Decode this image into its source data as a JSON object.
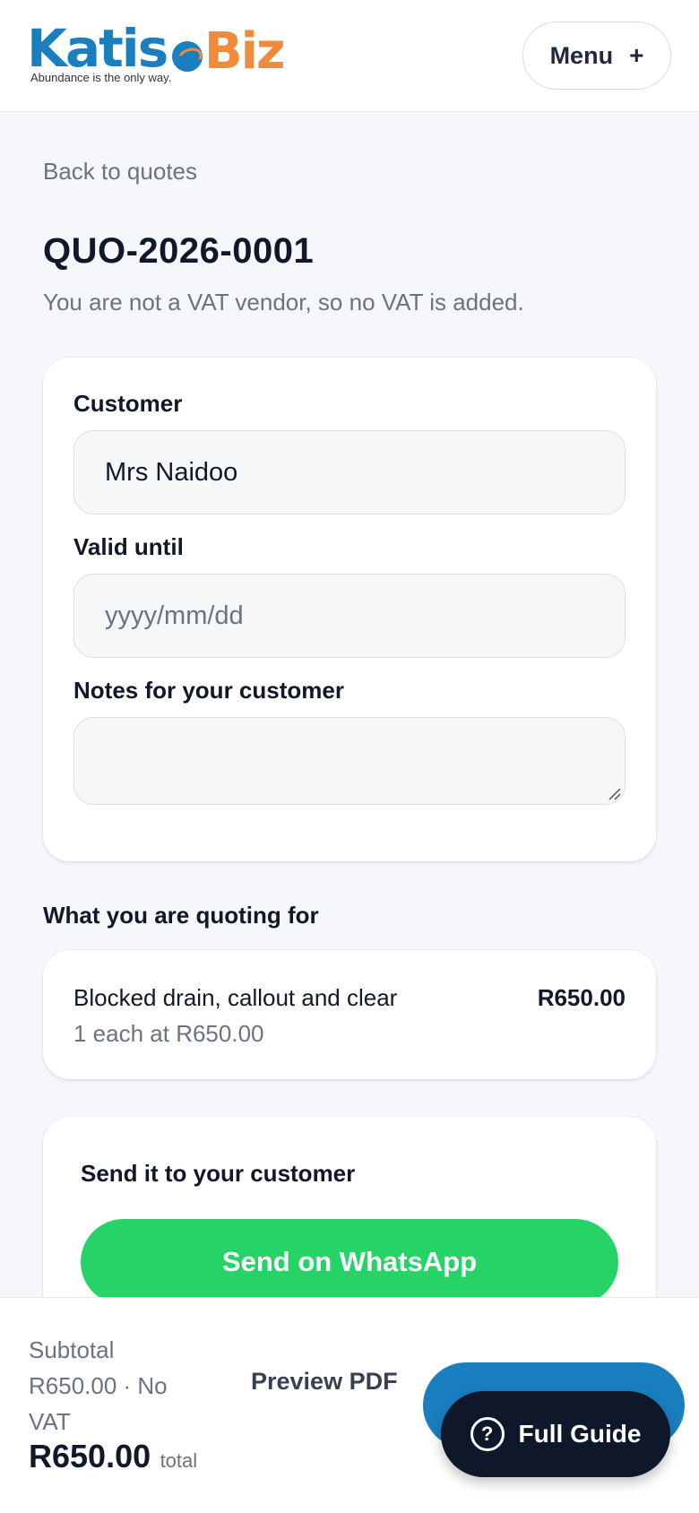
{
  "header": {
    "logo_part1": "Katis",
    "logo_part2": "Biz",
    "logo_tagline": "Abundance is the only way.",
    "menu_label": "Menu",
    "menu_icon": "+"
  },
  "nav": {
    "back_label": "Back to quotes"
  },
  "quote": {
    "number": "QUO-2026-0001",
    "vat_note": "You are not a VAT vendor, so no VAT is added."
  },
  "form": {
    "customer_label": "Customer",
    "customer_value": "Mrs Naidoo",
    "valid_until_label": "Valid until",
    "valid_until_placeholder": "yyyy/mm/dd",
    "notes_label": "Notes for your customer",
    "notes_value": ""
  },
  "items_section": {
    "heading": "What you are quoting for",
    "items": [
      {
        "name": "Blocked drain, callout and clear",
        "price": "R650.00",
        "detail": "1 each at R650.00"
      }
    ]
  },
  "send": {
    "title": "Send it to your customer",
    "whatsapp_label": "Send on WhatsApp"
  },
  "footer": {
    "subtotal_label": "Subtotal",
    "subtotal_value": "R650.00 · No VAT",
    "total_amount": "R650.00",
    "total_word": "total",
    "preview_label": "Preview PDF",
    "guide_label": "Full Guide",
    "guide_icon": "?"
  },
  "colors": {
    "brand_blue": "#1a7fbf",
    "brand_orange": "#f28a3c",
    "whatsapp_green": "#25d366",
    "guide_dark": "#0f172a"
  }
}
